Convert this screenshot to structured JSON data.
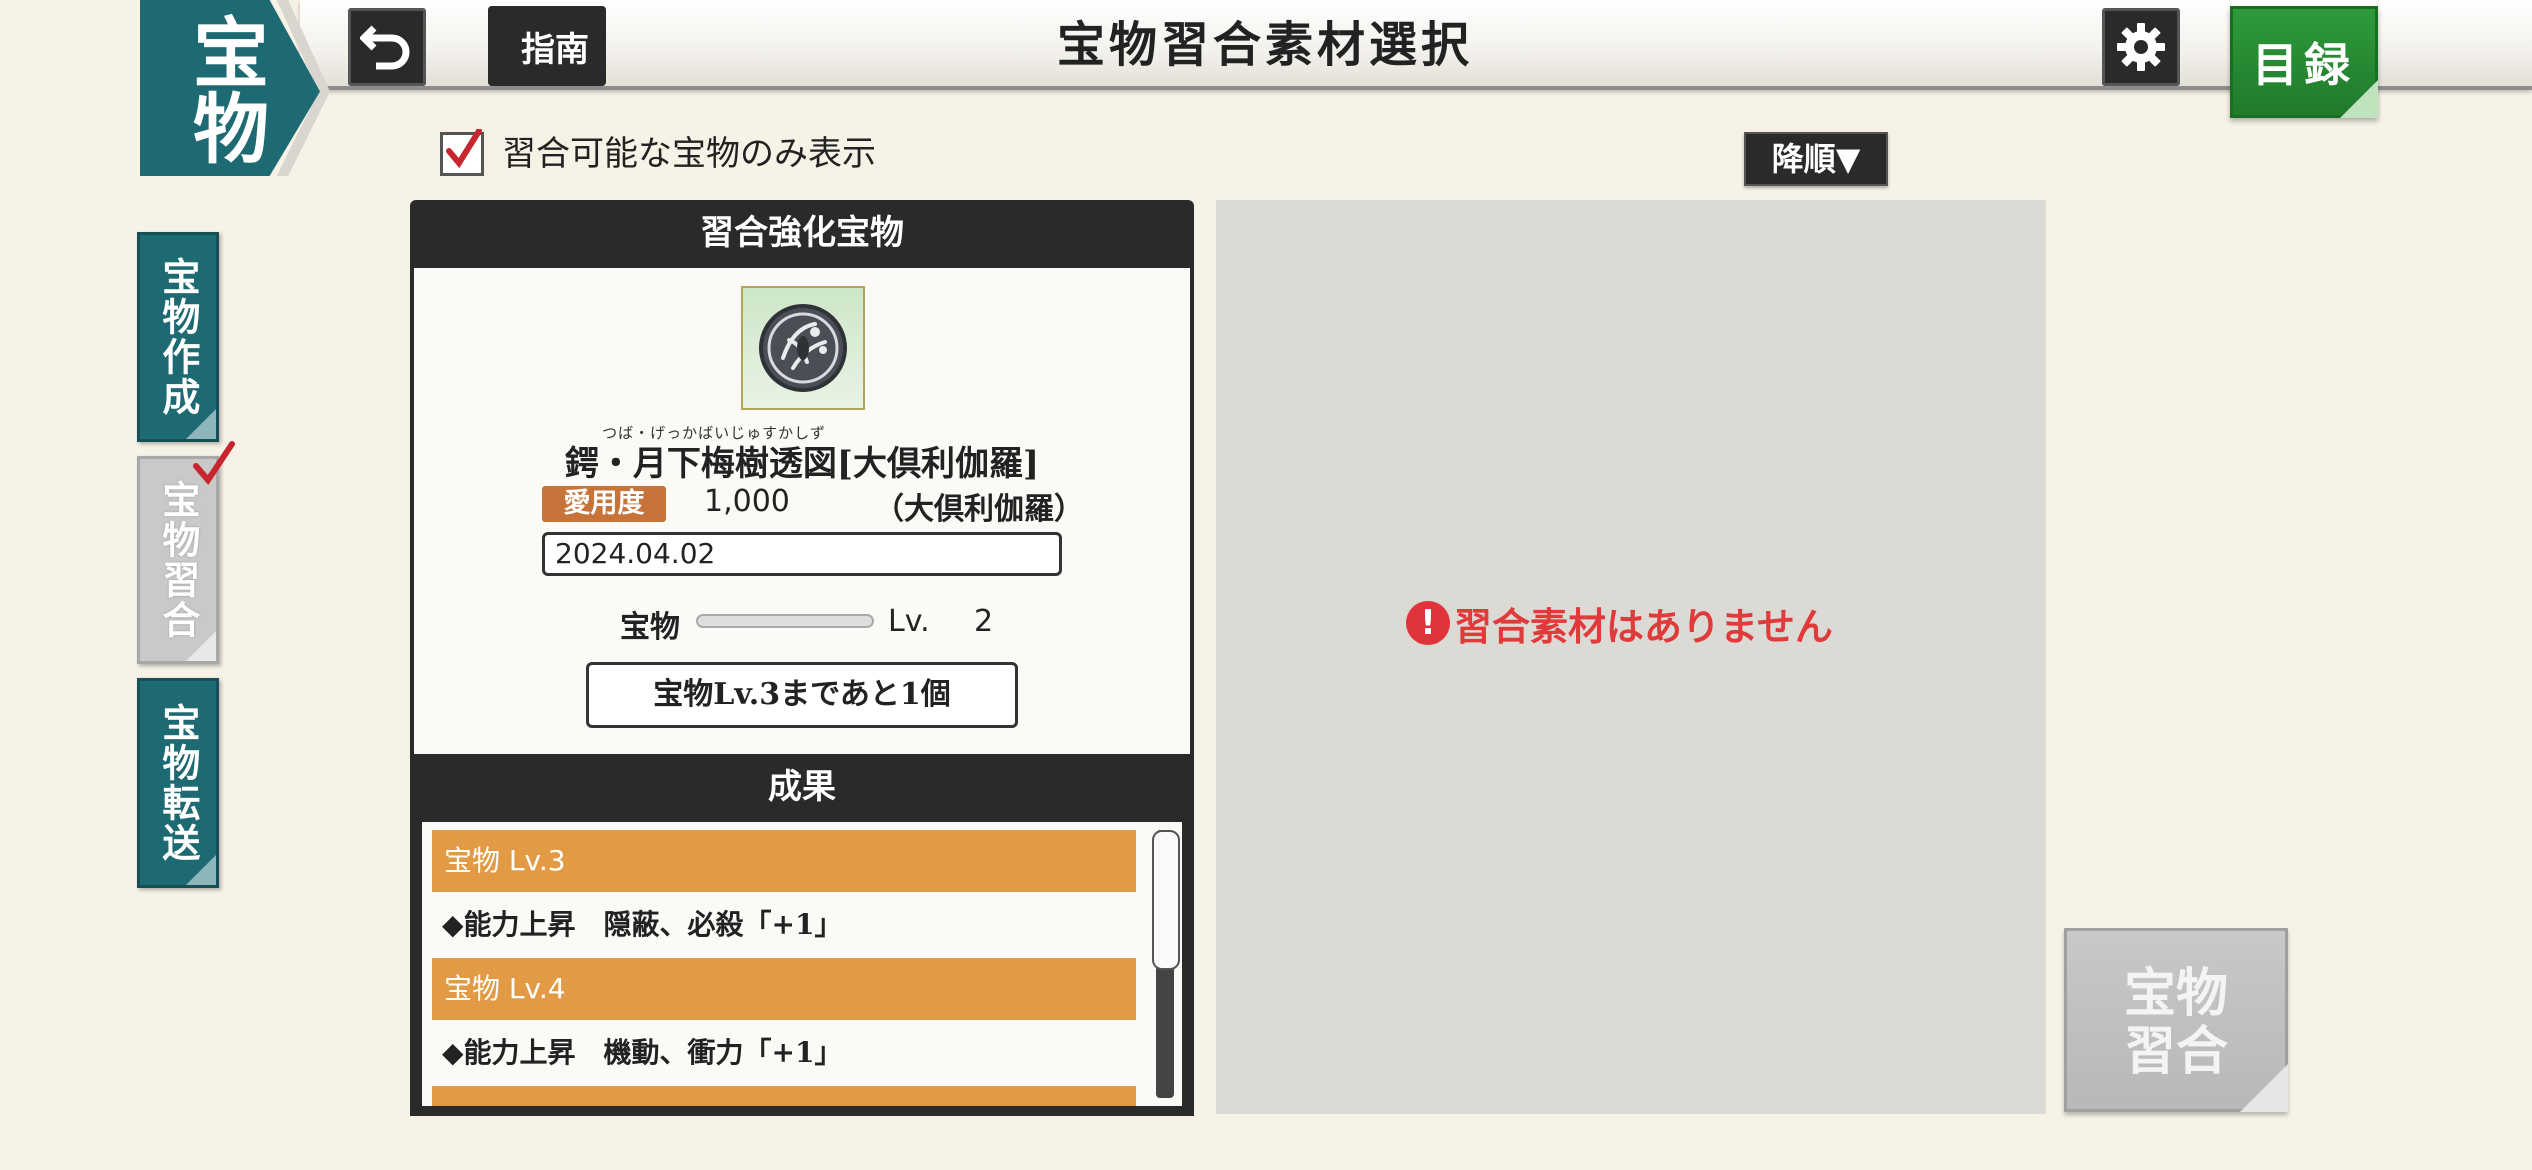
{
  "header": {
    "title": "宝物習合素材選択",
    "emblem": "宝物",
    "guide_label": "指南",
    "catalog_label": "目録"
  },
  "side_tabs": [
    {
      "label": "宝物作成",
      "state": "inactive"
    },
    {
      "label": "宝物習合",
      "state": "selected"
    },
    {
      "label": "宝物転送",
      "state": "inactive"
    }
  ],
  "filter": {
    "checked": true,
    "label": "習合可能な宝物のみ表示",
    "sort_label": "降順▼"
  },
  "target": {
    "heading": "習合強化宝物",
    "ruby": "つば・げっかばいじゅすかしず",
    "name": "鍔・月下梅樹透図[大倶利伽羅]",
    "affection_label": "愛用度",
    "affection_value": "1,000",
    "owner": "（大倶利伽羅）",
    "date": "2024.04.02",
    "level_label": "宝物",
    "level_prefix": "Lv.",
    "level_value": "2",
    "level_progress": 0,
    "remaining": "宝物Lv.3まであと1個"
  },
  "results": {
    "heading": "成果",
    "items": [
      {
        "level": "宝物 Lv.3",
        "desc": "◆能力上昇　隠蔽、必殺「+1」"
      },
      {
        "level": "宝物 Lv.4",
        "desc": "◆能力上昇　機動、衝力「+1」"
      }
    ]
  },
  "materials": {
    "empty_message": "習合素材はありません"
  },
  "fuse_button": {
    "line1": "宝物",
    "line2": "習合",
    "enabled": false
  },
  "colors": {
    "accent_teal": "#1e6a73",
    "result_orange": "#e39a45",
    "warning_red": "#e03a3a",
    "catalog_green": "#2e9a3c"
  }
}
